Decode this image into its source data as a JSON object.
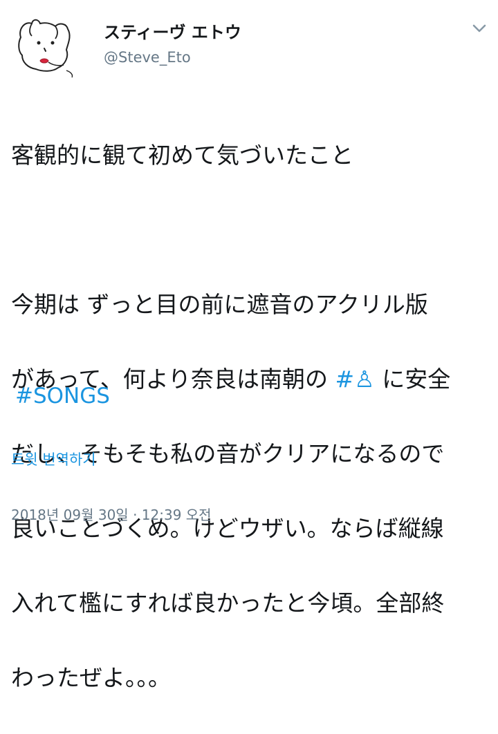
{
  "user": {
    "display_name": "スティーヴ エトウ",
    "handle": "@Steve_Eto",
    "avatar_icon": "dog-doodle-avatar"
  },
  "menu": {
    "icon": "chevron-down-icon"
  },
  "tweet": {
    "line1": "客観的に観て初めて気づいたこと",
    "line2": "今期は ずっと目の前に遮音のアクリル版",
    "line3_before": "があって、何より奈良は南朝の ",
    "line3_hashtag": "#♙",
    "line3_after": " に安全",
    "line4": "だし、そもそも私の音がクリアになるので",
    "line5": "良いことづくめ。けどウザい。ならば縦線",
    "line6": "入れて檻にすれば良かったと今頃。全部終",
    "line7": "わったぜよ。。。",
    "hashtag": "#SONGS"
  },
  "actions": {
    "translate_label": "트윗 번역하기"
  },
  "meta": {
    "timestamp": "2018년 09월 30일 · 12:39 오전"
  },
  "colors": {
    "link": "#1b95e0",
    "secondary_text": "#657786",
    "primary_text": "#14171a"
  }
}
